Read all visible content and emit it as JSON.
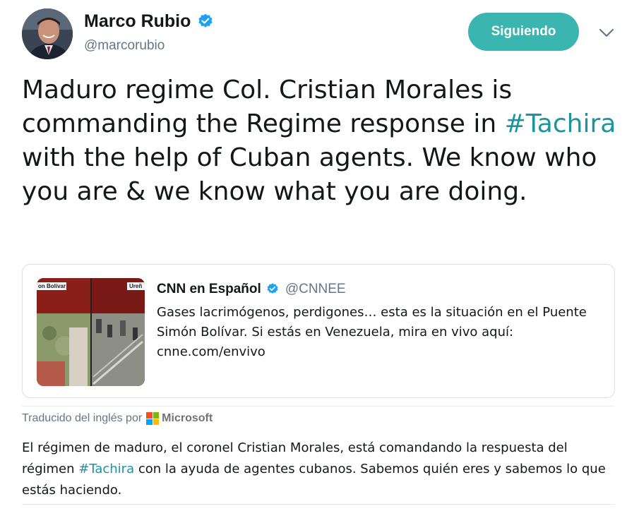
{
  "author": {
    "name": "Marco Rubio",
    "handle": "@marcorubio",
    "verified_icon": "verified-badge-icon"
  },
  "follow_button": {
    "label": "Siguiendo"
  },
  "menu": {
    "icon": "chevron-down-icon"
  },
  "tweet": {
    "text_before": "Maduro regime Col. Cristian Morales is commanding the Regime response in ",
    "hashtag": "#Tachira",
    "text_after": " with the help of Cuban agents. We know who you are & we know what you are doing."
  },
  "quote": {
    "name": "CNN en Español",
    "handle": "@CNNEE",
    "text": "Gases lacrimógenos, perdigones… esta es la situación en el Puente Simón Bolívar. Si estás en Venezuela, mira en vivo aquí: cnne.com/envivo",
    "thumb_caption": "on Bolívar",
    "thumb_caption_right": "Ureñ"
  },
  "translation": {
    "label": "Traducido del inglés por",
    "provider": "Microsoft",
    "text_before": "El régimen de maduro, el coronel Cristian Morales, está comandando la respuesta del régimen ",
    "hashtag": "#Tachira",
    "text_after": " con la ayuda de agentes cubanos. Sabemos quién eres y sabemos lo que estás haciendo."
  },
  "colors": {
    "accent": "#3ab5b0",
    "hashtag": "#1c94a0",
    "verified": "#1da1f2",
    "secondary_text": "#657786"
  }
}
